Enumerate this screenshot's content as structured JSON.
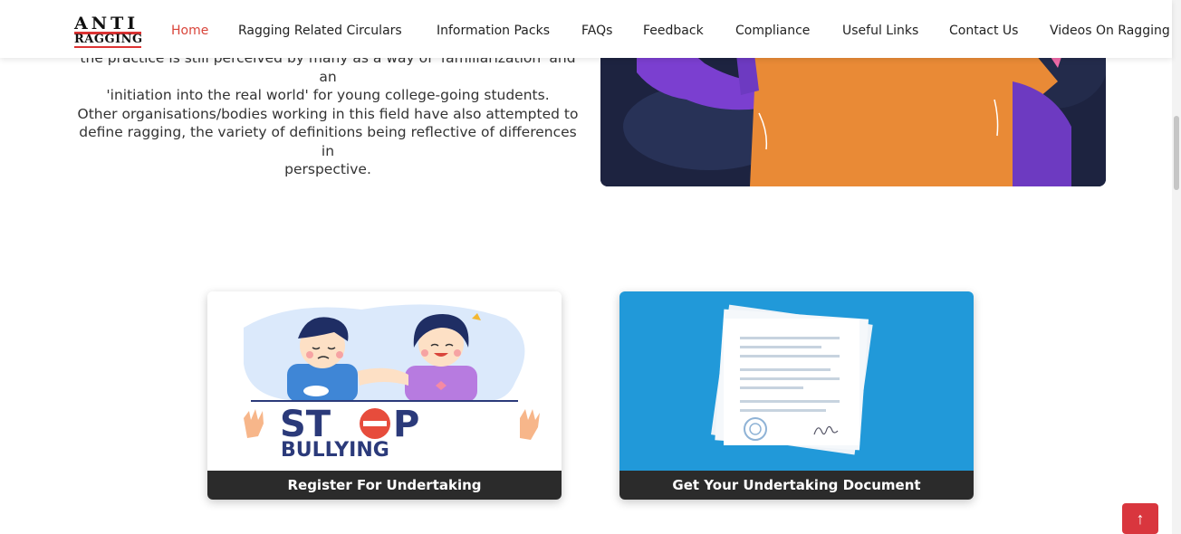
{
  "logo": {
    "line1": "ANTI",
    "line2": "RAGGING"
  },
  "nav": {
    "items": [
      {
        "label": "Home",
        "active": true
      },
      {
        "label": "Ragging Related Circulars"
      },
      {
        "label": "Information Packs"
      },
      {
        "label": "FAQs"
      },
      {
        "label": "Feedback"
      },
      {
        "label": "Compliance"
      },
      {
        "label": "Useful Links"
      },
      {
        "label": "Contact Us"
      },
      {
        "label": "Videos On Ragging"
      }
    ]
  },
  "intro": {
    "lines": [
      "the practice is still perceived by many as a way of 'familiarization' and an",
      "'initiation into the real world' for young college-going students.",
      "Other organisations/bodies working in this field have also attempted to",
      "define ragging, the variety of definitions being reflective of differences in",
      "perspective."
    ]
  },
  "cards": [
    {
      "caption": "Register For Undertaking",
      "stop_text": "ST",
      "stop_text2": "P",
      "bullying_text": "BULLYING"
    },
    {
      "caption": "Get Your Undertaking Document"
    }
  ],
  "colors": {
    "accent": "#d9453b",
    "caption_bg": "#2b2b2b",
    "card2_bg": "#2199d9",
    "hero_bg": "#1d2340"
  },
  "icons": {
    "back_to_top": "arrow-up-icon"
  },
  "back_to_top_glyph": "↑"
}
